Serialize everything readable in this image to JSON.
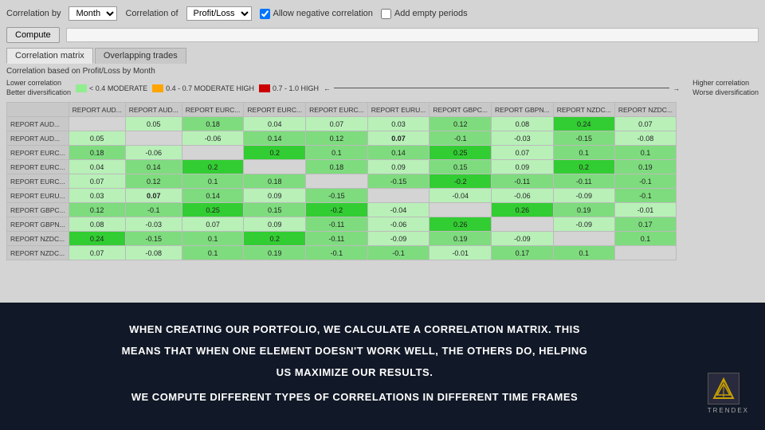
{
  "toolbar": {
    "correlation_by_label": "Correlation by",
    "correlation_by_value": "Month",
    "correlation_of_label": "Correlation of",
    "correlation_of_value": "Profit/Loss",
    "allow_negative_label": "Allow negative correlation",
    "add_empty_label": "Add empty periods",
    "compute_label": "Compute"
  },
  "tabs": [
    {
      "label": "Correlation matrix",
      "active": true
    },
    {
      "label": "Overlapping trades",
      "active": false
    }
  ],
  "correlation_info": "Correlation based on Profit/Loss by Month",
  "legend": {
    "lower_label": "Lower correlation",
    "better_label": "Better diversification",
    "higher_label": "Higher correlation",
    "worse_label": "Worse diversification",
    "items": [
      {
        "color": "#90ee90",
        "label": "< 0.4 MODERATE"
      },
      {
        "color": "#ffa500",
        "label": "0.4 - 0.7 MODERATE HIGH"
      },
      {
        "color": "#cc0000",
        "label": "0.7 - 1.0 HIGH"
      }
    ]
  },
  "matrix": {
    "headers": [
      "",
      "REPORT AUD...",
      "REPORT AUD...",
      "REPORT EURC...",
      "REPORT EURC...",
      "REPORT EURC...",
      "REPORT EURU...",
      "REPORT GBPC...",
      "REPORT GBPN...",
      "REPORT NZDC...",
      "REPORT NZDC..."
    ],
    "rows": [
      {
        "label": "REPORT AUD...",
        "cells": [
          "",
          "0.05",
          "0.18",
          "0.04",
          "0.07",
          "0.03",
          "0.12",
          "0.08",
          "0.24",
          "0.07"
        ]
      },
      {
        "label": "REPORT AUD...",
        "cells": [
          "0.05",
          "",
          "-0.06",
          "0.14",
          "0.12",
          "0.07",
          "-0.1",
          "-0.03",
          "-0.15",
          "-0.08"
        ]
      },
      {
        "label": "REPORT EURC...",
        "cells": [
          "0.18",
          "-0.06",
          "",
          "0.2",
          "0.1",
          "0.14",
          "0.25",
          "0.07",
          "0.1",
          "0.1"
        ]
      },
      {
        "label": "REPORT EURC...",
        "cells": [
          "0.04",
          "0.14",
          "0.2",
          "",
          "0.18",
          "0.09",
          "0.15",
          "0.09",
          "0.2",
          "0.19"
        ]
      },
      {
        "label": "REPORT EURC...",
        "cells": [
          "0.07",
          "0.12",
          "0.1",
          "0.18",
          "",
          "-0.15",
          "-0.2",
          "-0.11",
          "-0.11",
          "-0.1"
        ]
      },
      {
        "label": "REPORT EURU...",
        "cells": [
          "0.03",
          "0.07",
          "0.14",
          "0.09",
          "-0.15",
          "",
          "-0.04",
          "-0.06",
          "-0.09",
          "-0.1"
        ]
      },
      {
        "label": "REPORT GBPC...",
        "cells": [
          "0.12",
          "-0.1",
          "0.25",
          "0.15",
          "-0.2",
          "-0.04",
          "",
          "0.26",
          "0.19",
          "-0.01"
        ]
      },
      {
        "label": "REPORT GBPN...",
        "cells": [
          "0.08",
          "-0.03",
          "0.07",
          "0.09",
          "-0.11",
          "-0.06",
          "0.26",
          "",
          "-0.09",
          "0.17"
        ]
      },
      {
        "label": "REPORT NZDC...",
        "cells": [
          "0.24",
          "-0.15",
          "0.1",
          "0.2",
          "-0.11",
          "-0.09",
          "0.19",
          "-0.09",
          "",
          "0.1"
        ]
      },
      {
        "label": "REPORT NZDC...",
        "cells": [
          "0.07",
          "-0.08",
          "0.1",
          "0.19",
          "-0.1",
          "-0.1",
          "-0.01",
          "0.17",
          "0.1",
          ""
        ]
      }
    ]
  },
  "bottom": {
    "line1": "WHEN CREATING OUR PORTFOLIO, WE CALCULATE A CORRELATION MATRIX. THIS",
    "line2": "MEANS THAT WHEN ONE ELEMENT DOESN'T WORK WELL, THE OTHERS DO, HELPING",
    "line3": "US MAXIMIZE OUR RESULTS.",
    "line4": "WE COMPUTE DIFFERENT TYPES OF CORRELATIONS IN DIFFERENT TIME FRAMES",
    "logo_text": "TRENDEX"
  }
}
